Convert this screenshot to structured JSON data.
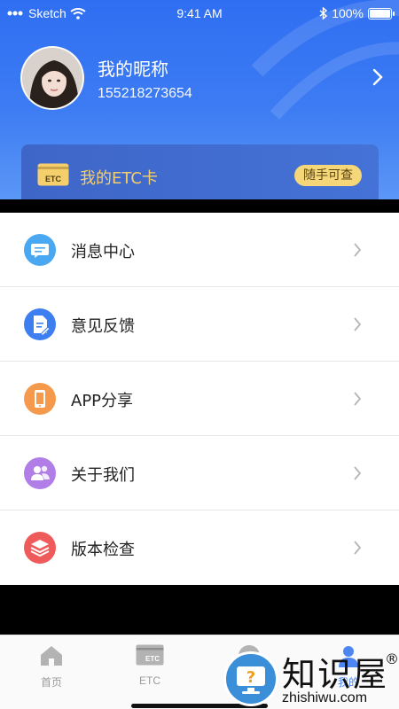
{
  "status_bar": {
    "carrier": "Sketch",
    "time": "9:41 AM",
    "battery": "100%"
  },
  "profile": {
    "nickname": "我的昵称",
    "phone": "155218273654"
  },
  "etc_card": {
    "title": "我的ETC卡",
    "badge": "随手可查",
    "icon_text": "ETC"
  },
  "menu": {
    "items": [
      {
        "label": "消息中心",
        "icon": "message-icon",
        "color": "#4aa8f2"
      },
      {
        "label": "意见反馈",
        "icon": "feedback-doc-icon",
        "color": "#3d7ef0"
      },
      {
        "label": "APP分享",
        "icon": "phone-share-icon",
        "color": "#f59a4c"
      },
      {
        "label": "关于我们",
        "icon": "users-icon",
        "color": "#b07ee6"
      },
      {
        "label": "版本检查",
        "icon": "layers-icon",
        "color": "#ef5a5a"
      }
    ]
  },
  "tabbar": {
    "tabs": [
      {
        "label": "首页"
      },
      {
        "label": "ETC"
      },
      {
        "label": ""
      },
      {
        "label": "我的"
      }
    ]
  },
  "watermark": {
    "title": "知识屋",
    "subtitle": "zhishiwu.com",
    "reg": "®"
  },
  "colors": {
    "header_blue": "#2f6ef2",
    "gold": "#f5cf6b",
    "active_tab": "#4d86f3"
  }
}
